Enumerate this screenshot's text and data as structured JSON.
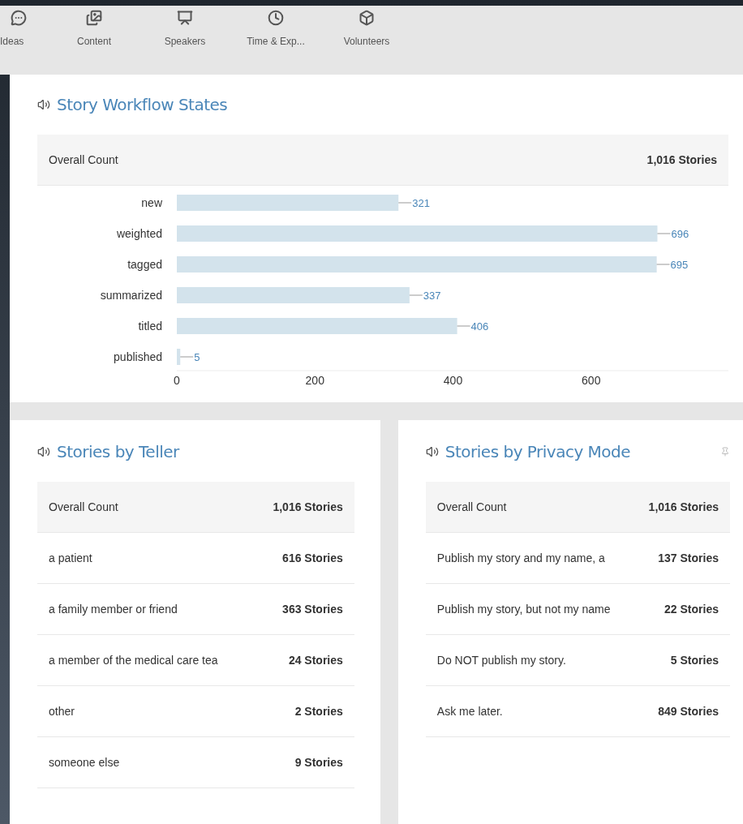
{
  "toolbar": [
    {
      "label": "Ideas",
      "kind": "ideas"
    },
    {
      "label": "Content",
      "kind": "content"
    },
    {
      "label": "Speakers",
      "kind": "speakers"
    },
    {
      "label": "Time & Exp...",
      "kind": "time"
    },
    {
      "label": "Volunteers",
      "kind": "volunteers"
    }
  ],
  "workflow": {
    "title": "Story Workflow States",
    "overall": {
      "label": "Overall Count",
      "value": "1,016 Stories"
    },
    "chart_data": {
      "type": "bar",
      "orientation": "horizontal",
      "categories": [
        "new",
        "weighted",
        "tagged",
        "summarized",
        "titled",
        "published"
      ],
      "series": [
        {
          "color": "#d3e3ec",
          "values": [
            321,
            696,
            695,
            337,
            406,
            5
          ]
        }
      ],
      "xlim": [
        0,
        800
      ],
      "xticks": [
        0,
        200,
        400,
        600
      ],
      "data_labels": true
    }
  },
  "teller": {
    "title": "Stories by Teller",
    "overall": {
      "label": "Overall Count",
      "value": "1,016 Stories"
    },
    "rows": [
      {
        "label": "a patient",
        "value": "616 Stories"
      },
      {
        "label": "a family member or friend",
        "value": "363 Stories"
      },
      {
        "label": "a member of the medical care tea",
        "value": "24 Stories"
      },
      {
        "label": "other",
        "value": "2 Stories"
      },
      {
        "label": "someone else",
        "value": "9 Stories"
      }
    ]
  },
  "privacy": {
    "title": "Stories by Privacy Mode",
    "overall": {
      "label": "Overall Count",
      "value": "1,016 Stories"
    },
    "rows": [
      {
        "label": "Publish my story and my name, a",
        "value": "137 Stories"
      },
      {
        "label": "Publish my story, but not my name",
        "value": "22 Stories"
      },
      {
        "label": "Do NOT publish my story.",
        "value": "5 Stories"
      },
      {
        "label": "Ask me later.",
        "value": "849 Stories"
      }
    ]
  }
}
